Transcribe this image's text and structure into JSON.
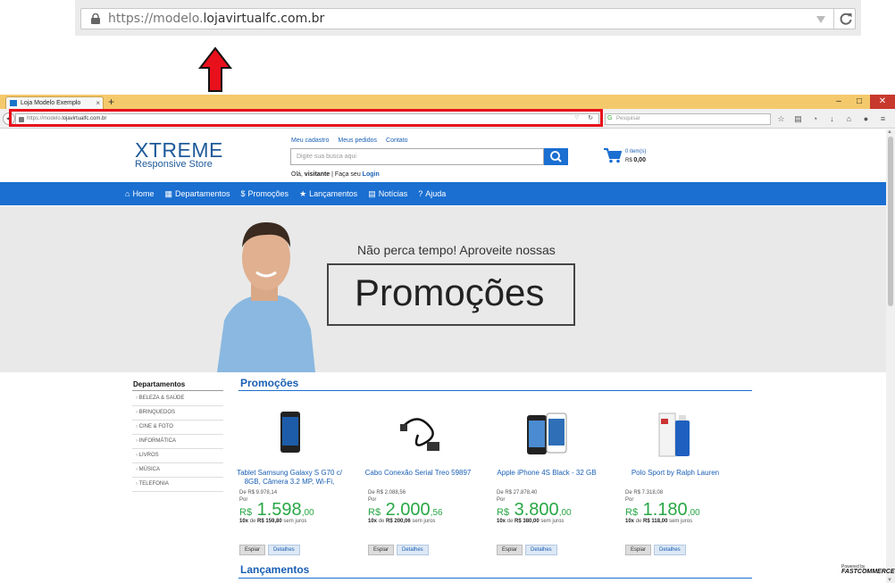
{
  "zoomed_url": {
    "prefix": "https://modelo.",
    "domain": "lojavirtualfc.com.br"
  },
  "browser": {
    "tab_title": "Loja Modelo Exemplo",
    "new_tab": "+",
    "url_prefix": "https://modelo.",
    "url_domain": "lojavirtualfc.com.br",
    "search_placeholder": "Pesquisar",
    "win_min": "–",
    "win_max": "□",
    "win_close": "✕"
  },
  "store": {
    "logo_main": "XTREME",
    "logo_sub": "Responsive Store",
    "links": [
      "Meu cadastro",
      "Meus pedidos",
      "Contato"
    ],
    "search_placeholder": "Digite sua busca aqui",
    "welcome_prefix": "Olá,",
    "welcome_user": "visitante",
    "welcome_mid": "| Faça seu",
    "login": "Login",
    "cart_items": "0 item(s)",
    "cart_total_label": "R$",
    "cart_total": "0,00"
  },
  "nav": [
    "Home",
    "Departamentos",
    "Promoções",
    "Lançamentos",
    "Notícias",
    "Ajuda"
  ],
  "banner": {
    "top": "Não perca tempo! Aproveite nossas",
    "big": "Promoções"
  },
  "departments": {
    "title": "Departamentos",
    "items": [
      "BELEZA & SAÚDE",
      "BRINQUEDOS",
      "CINE & FOTO",
      "INFORMÁTICA",
      "LIVROS",
      "MÚSICA",
      "TELEFONIA"
    ]
  },
  "sections": {
    "promo": "Promoções",
    "launch": "Lançamentos"
  },
  "products": [
    {
      "name": "Tablet Samsung Galaxy S G70 c/ 8GB, Câmera 3.2 MP, Wi-Fi,",
      "old": "De  R$ 9.978,14",
      "por": "Por",
      "cur": "R$",
      "price": "1.598",
      "cents": ",00",
      "inst_x": "10x",
      "inst_de": "de",
      "inst_val": "R$ 159,80",
      "inst_sj": "sem juros",
      "btn1": "Espiar",
      "btn2": "Detalhes",
      "img": "phone-icon"
    },
    {
      "name": "Cabo Conexão Serial Treo 59897",
      "old": "De  R$ 2.088,56",
      "por": "Por",
      "cur": "R$",
      "price": "2.000",
      "cents": ",56",
      "inst_x": "10x",
      "inst_de": "de",
      "inst_val": "R$ 200,06",
      "inst_sj": "sem juros",
      "btn1": "Espiar",
      "btn2": "Detalhes",
      "img": "cable-icon"
    },
    {
      "name": "Apple iPhone 4S Black - 32 GB",
      "old": "De  R$ 27.878,40",
      "por": "Por",
      "cur": "R$",
      "price": "3.800",
      "cents": ",00",
      "inst_x": "10x",
      "inst_de": "de",
      "inst_val": "R$ 380,00",
      "inst_sj": "sem juros",
      "btn1": "Espiar",
      "btn2": "Detalhes",
      "img": "iphone-icon"
    },
    {
      "name": "Polo Sport by Ralph Lauren",
      "old": "De  R$ 7.318,08",
      "por": "Por",
      "cur": "R$",
      "price": "1.180",
      "cents": ",00",
      "inst_x": "10x",
      "inst_de": "de",
      "inst_val": "R$ 118,00",
      "inst_sj": "sem juros",
      "btn1": "Espiar",
      "btn2": "Detalhes",
      "img": "perfume-icon"
    }
  ],
  "powered": {
    "line1": "Powered by",
    "line2": "FASTCOMMERCE"
  },
  "colors": {
    "brand": "#1a6fd1",
    "price": "#28a745",
    "highlight": "#e8101b"
  }
}
